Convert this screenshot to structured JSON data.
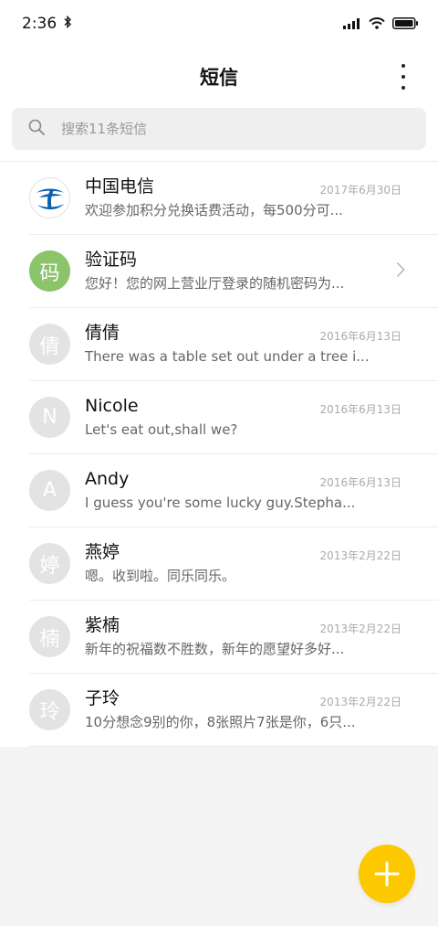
{
  "status_bar": {
    "time": "2:36"
  },
  "header": {
    "title": "短信"
  },
  "search": {
    "placeholder": "搜索11条短信"
  },
  "conversations": [
    {
      "name": "中国电信",
      "preview": "欢迎参加积分兑换话费活动，每500分可...",
      "date": "2017年6月30日",
      "avatar": "telecom-logo",
      "avatar_text": ""
    },
    {
      "name": "验证码",
      "preview": "您好！您的网上营业厅登录的随机密码为...",
      "date": "",
      "avatar": "green",
      "avatar_text": "码"
    },
    {
      "name": "倩倩",
      "preview": "There was a table set out under a tree i...",
      "date": "2016年6月13日",
      "avatar": "gray",
      "avatar_text": "倩"
    },
    {
      "name": "Nicole",
      "preview": "Let's eat out,shall we?",
      "date": "2016年6月13日",
      "avatar": "gray",
      "avatar_text": "N"
    },
    {
      "name": "Andy",
      "preview": "I guess you're some lucky guy.Stepha...",
      "date": "2016年6月13日",
      "avatar": "gray",
      "avatar_text": "A"
    },
    {
      "name": "燕婷",
      "preview": "嗯。收到啦。同乐同乐。",
      "date": "2013年2月22日",
      "avatar": "gray",
      "avatar_text": "婷"
    },
    {
      "name": "紫楠",
      "preview": "新年的祝福数不胜数，新年的愿望好多好...",
      "date": "2013年2月22日",
      "avatar": "gray",
      "avatar_text": "楠"
    },
    {
      "name": "子玲",
      "preview": "10分想念9别的你，8张照片7张是你，6只...",
      "date": "2013年2月22日",
      "avatar": "gray",
      "avatar_text": "玲"
    }
  ],
  "colors": {
    "fab": "#fcc900",
    "green_avatar": "#8cc469",
    "gray_avatar": "#e3e3e3",
    "telecom_blue": "#0b5fb0"
  }
}
